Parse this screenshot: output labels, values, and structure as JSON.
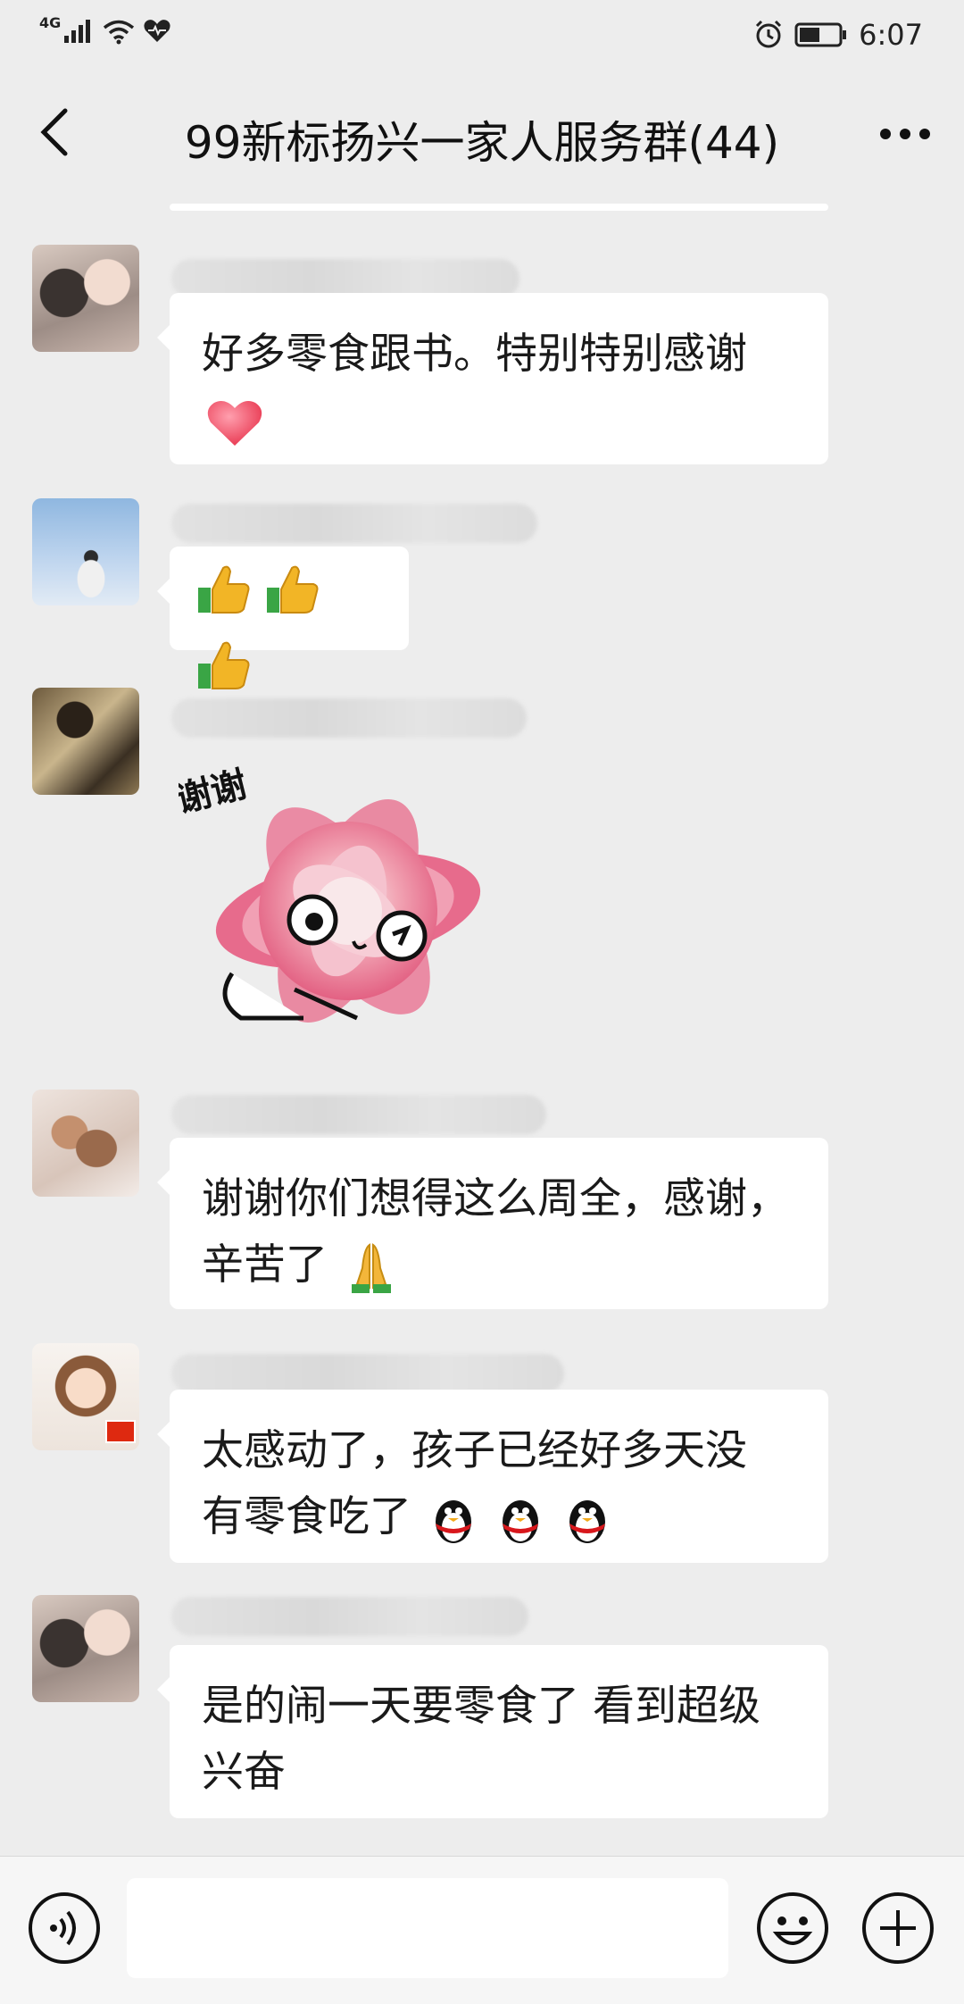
{
  "status_bar": {
    "network": "4G",
    "time": "6:07"
  },
  "header": {
    "title": "99新标扬兴一家人服务群(44)"
  },
  "messages": [
    {
      "text": "好多零食跟书。特别特别感谢",
      "emoji": "heart-emoji"
    },
    {
      "text": "",
      "emoji": "thumbs-up-emoji x3"
    },
    {
      "sticker_text": "谢谢",
      "sticker": "pink-succulent-thank-you-sticker"
    },
    {
      "line1": "谢谢你们想得这么周全，感谢，",
      "line2": "辛苦了",
      "emoji": "praying-hands-emoji"
    },
    {
      "line1": "太感动了，孩子已经好多天没",
      "line2": "有零食吃了",
      "emoji": "qq-penguin-emoji x3"
    },
    {
      "line1": "是的闹一天要零食了 看到超级",
      "line2": "兴奋"
    }
  ],
  "colors": {
    "background": "#ededed",
    "bubble": "#ffffff",
    "text": "#1a1a1a"
  }
}
